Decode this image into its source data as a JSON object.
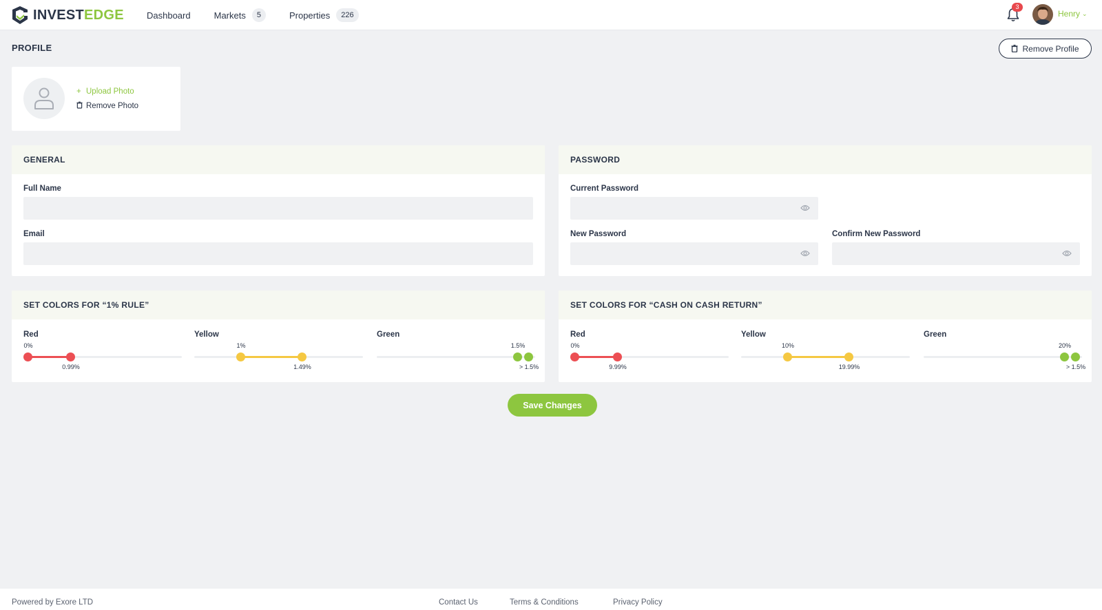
{
  "brand": {
    "name_part1": "INVEST",
    "name_part2": "EDGE",
    "accent": "#8dc63f",
    "dark": "#2b3548"
  },
  "nav": [
    {
      "label": "Dashboard",
      "count": ""
    },
    {
      "label": "Markets",
      "count": "5"
    },
    {
      "label": "Properties",
      "count": "226"
    }
  ],
  "notifications": {
    "count": "3",
    "icon": "bell-icon"
  },
  "user": {
    "name": "Henry"
  },
  "page": {
    "title": "PROFILE",
    "remove_profile": "Remove Profile"
  },
  "photo": {
    "upload": "Upload Photo",
    "remove": "Remove Photo"
  },
  "general": {
    "title": "GENERAL",
    "full_name_label": "Full Name",
    "full_name_value": "",
    "email_label": "Email",
    "email_value": ""
  },
  "password": {
    "title": "PASSWORD",
    "current_label": "Current Password",
    "new_label": "New Password",
    "confirm_label": "Confirm New Password"
  },
  "rule_colors": {
    "title": "SET COLORS FOR “1% RULE”",
    "red": {
      "label": "Red",
      "min_label": "0%",
      "max_label": "0.99%",
      "range": [
        0,
        0.99
      ]
    },
    "yellow": {
      "label": "Yellow",
      "min_label": "1%",
      "max_label": "1.49%",
      "range": [
        1,
        1.49
      ]
    },
    "green": {
      "label": "Green",
      "min_label": "1.5%",
      "max_label": "> 1.5%",
      "range": [
        1.5,
        1.5
      ]
    }
  },
  "coc_colors": {
    "title": "SET COLORS FOR “CASH ON CASH RETURN”",
    "red": {
      "label": "Red",
      "min_label": "0%",
      "max_label": "9.99%",
      "range": [
        0,
        9.99
      ]
    },
    "yellow": {
      "label": "Yellow",
      "min_label": "10%",
      "max_label": "19.99%",
      "range": [
        10,
        19.99
      ]
    },
    "green": {
      "label": "Green",
      "min_label": "20%",
      "max_label": "> 1.5%",
      "range": [
        20,
        20
      ]
    }
  },
  "colors": {
    "red": "#ec4f54",
    "yellow": "#f5c842",
    "green": "#8dc63f"
  },
  "save_label": "Save Changes",
  "footer": {
    "powered": "Powered by Exore LTD",
    "contact": "Contact Us",
    "terms": "Terms & Conditions",
    "privacy": "Privacy Policy"
  }
}
